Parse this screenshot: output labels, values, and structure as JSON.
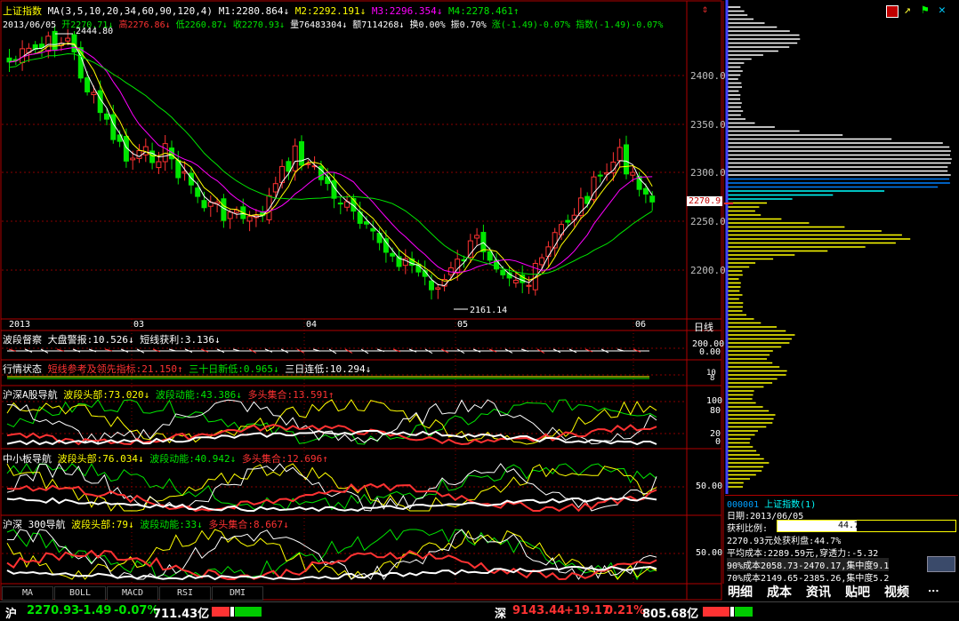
{
  "header": {
    "index_name": "上证指数",
    "ma_params": "MA(3,5,10,20,34,60,90,120,4)",
    "m1": "M1:2280.864↓",
    "m2": "M2:2292.191↓",
    "m3": "M3:2296.354↓",
    "m4": "M4:2278.461↑",
    "date": "2013/06/05",
    "open": "开2270.71↓",
    "high": "高2276.86↓",
    "low": "低2260.87↓",
    "close": "收2270.93↓",
    "volume": "量76483304↓",
    "amount": "额7114268↓",
    "turnover": "换0.00%",
    "amplitude": "振0.70%",
    "change": "涨(-1.49)-0.07%",
    "index_change": "指数(-1.49)-0.07%"
  },
  "price_axis": [
    "2400.0",
    "2350.0",
    "2300.0",
    "2250.0",
    "2200.0"
  ],
  "current_price_tag": "2270.9",
  "annotations": {
    "high": "2444.80",
    "low": "2161.14"
  },
  "month_labels": [
    "2013",
    "03",
    "04",
    "05",
    "06"
  ],
  "period_label": "日线",
  "indicators": {
    "p1": {
      "name": "波段督察",
      "t1": "大盘警报:10.526↓",
      "t2": "短线获利:3.136↓",
      "axis": [
        "200.00",
        "0.00"
      ]
    },
    "p2": {
      "name": "行情状态",
      "t1": "短线参考及领先指标:21.150↑",
      "t2": "三十日新低:0.965↓",
      "t3": "三日连低:10.294↓",
      "axis": [
        "10",
        "8"
      ]
    },
    "p3": {
      "name": "沪深A股导航",
      "t1": "波段头部:73.020↓",
      "t2": "波段动能:43.386↓",
      "t3": "多头集合:13.591↑",
      "axis": [
        "100",
        "80",
        "20",
        "0"
      ]
    },
    "p4": {
      "name": "中小板导航",
      "t1": "波段头部:76.034↓",
      "t2": "波段动能:40.942↓",
      "t3": "多头集合:12.696↑",
      "axis": [
        "50.00"
      ]
    },
    "p5": {
      "name": "沪深 300导航",
      "t1": "波段头部:79↓",
      "t2": "波段动能:33↓",
      "t3": "多头集合:8.667↓",
      "axis": [
        "50.00"
      ]
    }
  },
  "bottom_tabs": [
    "MA",
    "BOLL",
    "MACD",
    "RSI",
    "DMI"
  ],
  "chip_panel": {
    "code": "000001",
    "name": "上证指数(1)",
    "date": "日期:2013/06/05",
    "profit_label": "获利比例:",
    "profit_value": "44.7%",
    "line1": "2270.93元处获利盘:44.7%",
    "line2": "平均成本:2289.59元,穿透力:-5.32",
    "line3": "90%成本2058.73-2470.17,集中度9.1",
    "line4": "70%成本2149.65-2385.26,集中度5.2"
  },
  "right_tabs": [
    "明细",
    "成本",
    "资讯",
    "贴吧",
    "视频",
    "..."
  ],
  "status_bar": {
    "sh_label": "沪",
    "sh_value": "2270.93",
    "sh_change": "-1.49",
    "sh_pct": "-0.07%",
    "sh_amount": "711.43亿",
    "sz_label": "深",
    "sz_value": "9143.44",
    "sz_change": "+19.17",
    "sz_pct": "0.21%",
    "sz_amount": "805.68亿"
  },
  "colors": {
    "up": "#ff3232",
    "down": "#00e600",
    "ma1": "#ffffff",
    "ma2": "#ffff00",
    "ma3": "#ff00ff",
    "ma4": "#00e600",
    "frame": "#b00000"
  }
}
